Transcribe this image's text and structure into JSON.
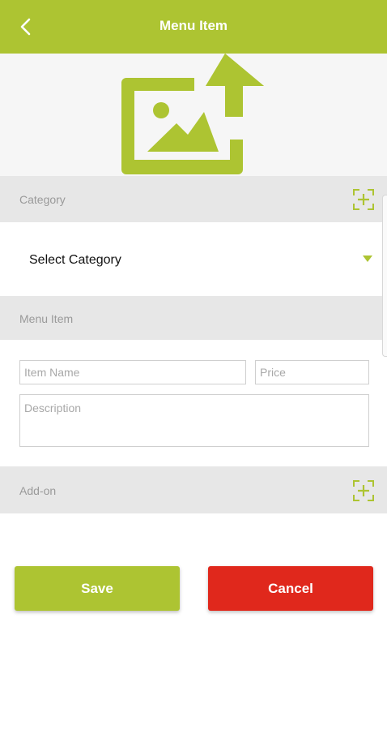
{
  "colors": {
    "accent": "#adc432",
    "danger": "#e0281c",
    "section_bg": "#e7e7e7"
  },
  "header": {
    "title": "Menu Item",
    "back_icon": "chevron-left-icon"
  },
  "image_upload": {
    "icon": "image-upload-icon"
  },
  "category": {
    "section_label": "Category",
    "add_icon": "add-square-icon",
    "selected": "Select Category"
  },
  "menu_item": {
    "section_label": "Menu Item",
    "name_placeholder": "Item Name",
    "price_placeholder": "Price",
    "description_placeholder": "Description"
  },
  "addon": {
    "section_label": "Add-on",
    "add_icon": "add-square-icon"
  },
  "actions": {
    "save_label": "Save",
    "cancel_label": "Cancel"
  }
}
